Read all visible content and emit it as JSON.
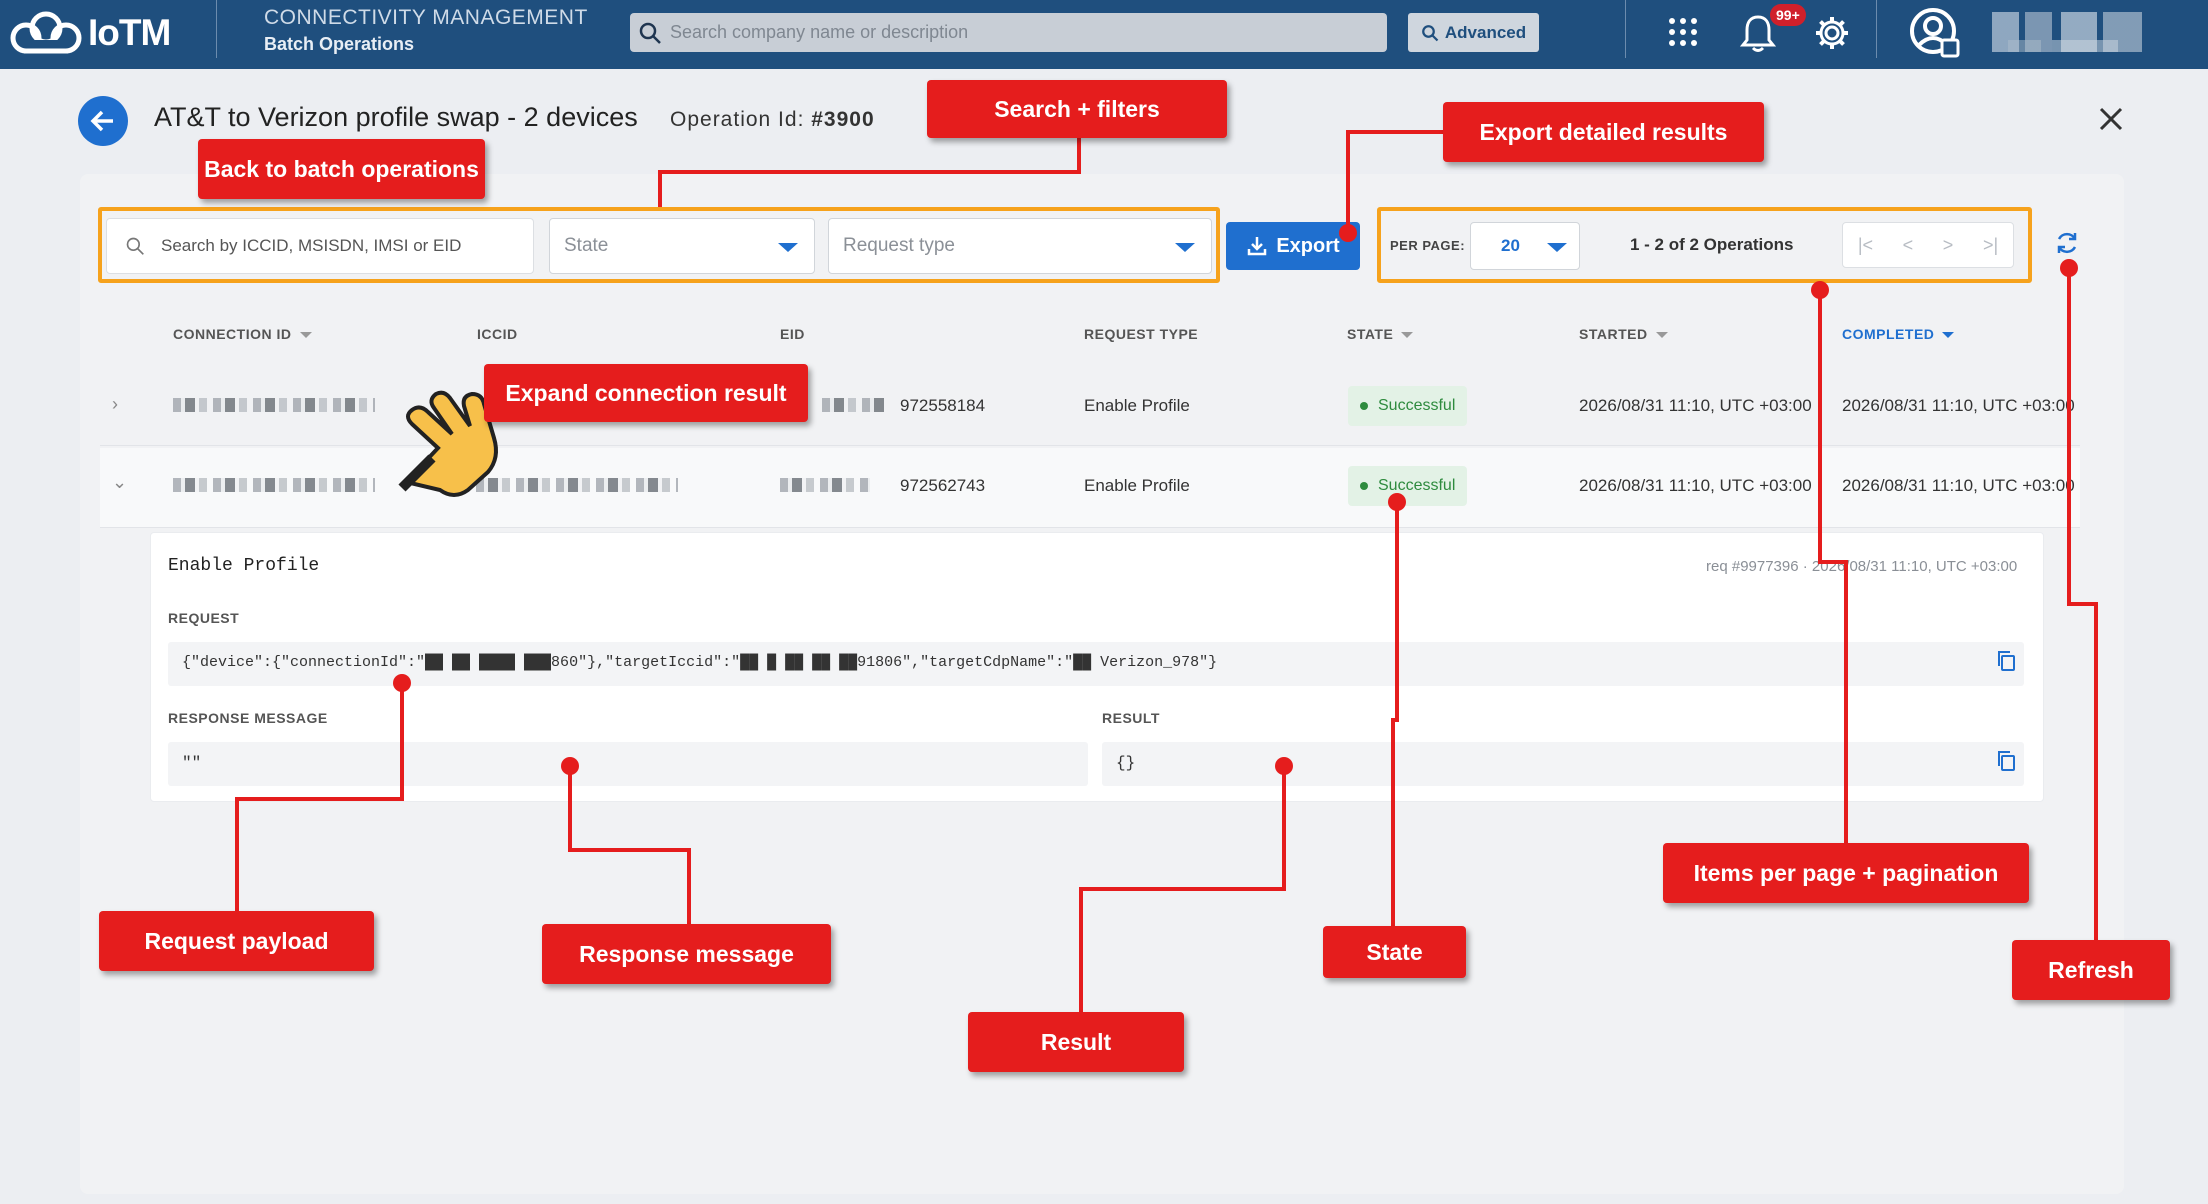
{
  "app": {
    "logo_text": "IoTM",
    "section_title": "CONNECTIVITY MANAGEMENT",
    "section_subtitle": "Batch Operations",
    "search_placeholder": "Search company name or description",
    "advanced_label": "Advanced",
    "notifications_badge": "99+"
  },
  "page": {
    "title": "AT&T to Verizon profile swap - 2 devices",
    "operation_id_label": "Operation Id:",
    "operation_id_value": "#3900"
  },
  "filters": {
    "search_placeholder": "Search by ICCID, MSISDN, IMSI or EID",
    "state_placeholder": "State",
    "request_type_placeholder": "Request type",
    "export_label": "Export"
  },
  "pagination": {
    "per_page_label": "PER PAGE:",
    "per_page_value": "20",
    "range_text": "1 - 2 of 2 Operations"
  },
  "table": {
    "headers": {
      "connection_id": "CONNECTION ID",
      "iccid": "ICCID",
      "eid": "EID",
      "request_type": "REQUEST TYPE",
      "state": "STATE",
      "started": "STARTED",
      "completed": "COMPLETED"
    },
    "rows": [
      {
        "eid_suffix": "972558184",
        "request_type": "Enable Profile",
        "state": "Successful",
        "started": "2026/08/31 11:10, UTC +03:00",
        "completed": "2026/08/31 11:10, UTC +03:00"
      },
      {
        "eid_suffix": "972562743",
        "request_type": "Enable Profile",
        "state": "Successful",
        "started": "2026/08/31 11:10, UTC +03:00",
        "completed": "2026/08/31 11:10, UTC +03:00"
      }
    ]
  },
  "detail": {
    "title": "Enable Profile",
    "meta": "req #9977396 · 2026/08/31 11:10, UTC +03:00",
    "request_label": "REQUEST",
    "request_payload": "{\"device\":{\"connectionId\":\"██ ██ ████ ███860\"},\"targetIccid\":\"██ █ ██ ██ ██91806\",\"targetCdpName\":\"██ Verizon_978\"}",
    "response_label": "RESPONSE MESSAGE",
    "response_value": "\"\"",
    "result_label": "RESULT",
    "result_value": "{}"
  },
  "annotations": {
    "back": "Back to batch operations",
    "search_filters": "Search + filters",
    "export": "Export detailed results",
    "expand": "Expand connection result",
    "request_payload": "Request payload",
    "response_message": "Response message",
    "result": "Result",
    "state": "State",
    "pagination": "Items per page + pagination",
    "refresh": "Refresh"
  },
  "colors": {
    "topbar": "#1f4f7e",
    "accent": "#1f6fcf",
    "annotation": "#e51d1d",
    "highlight_box": "#f6a21c",
    "success": "#2e8b3e"
  }
}
